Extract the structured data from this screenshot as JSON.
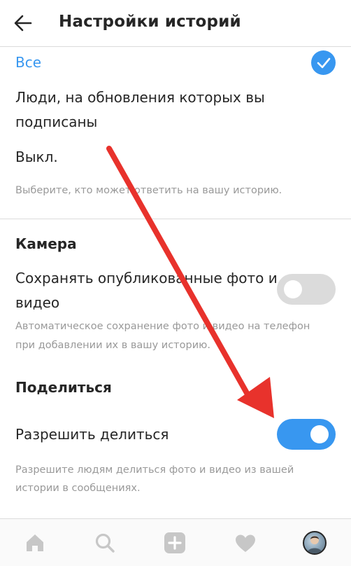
{
  "header": {
    "title": "Настройки историй"
  },
  "reply_options": {
    "items": [
      {
        "label": "Все",
        "selected": true
      },
      {
        "label_line1": "Люди, на обновления которых вы",
        "label_line2": "подписаны",
        "selected": false
      },
      {
        "label": "Выкл.",
        "selected": false
      }
    ],
    "hint": "Выберите, кто может ответить на вашу историю."
  },
  "camera": {
    "title": "Камера",
    "save_label_line1": "Сохранять опубликованные фото и",
    "save_label_line2": "видео",
    "save_enabled": false,
    "hint_line1": "Автоматическое сохранение фото и видео на телефон",
    "hint_line2": "при добавлении их в вашу историю."
  },
  "sharing": {
    "title": "Поделиться",
    "allow_label": "Разрешить делиться",
    "allow_enabled": true,
    "hint_line1": "Разрешите людям делиться фото и видео из вашей",
    "hint_line2": "истории в сообщениях."
  },
  "tabbar": {
    "icons": [
      "home-icon",
      "search-icon",
      "add-post-icon",
      "activity-heart-icon",
      "profile-avatar"
    ]
  },
  "colors": {
    "accent": "#3897f0",
    "annotation_arrow": "#e8322c",
    "toggle_off": "#dbdbdb"
  }
}
